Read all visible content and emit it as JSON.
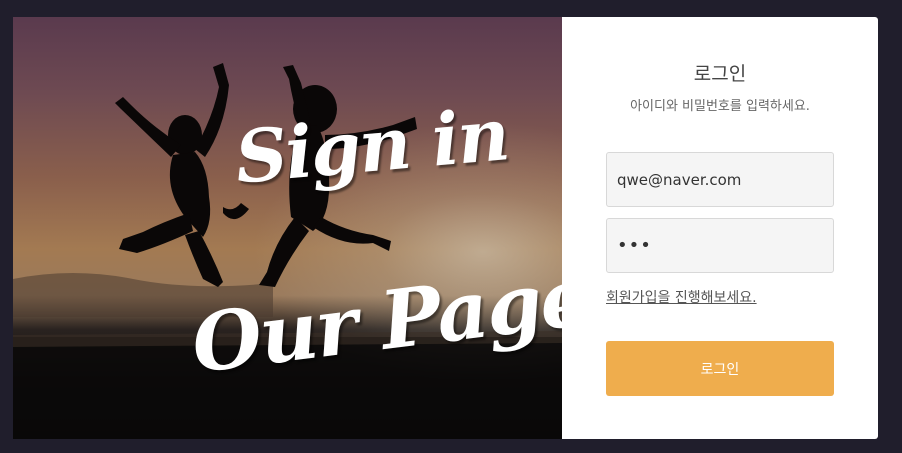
{
  "hero": {
    "line1": "Sign in",
    "line2": "Our Page!"
  },
  "login": {
    "title": "로그인",
    "subtitle": "아이디와 비밀번호를 입력하세요.",
    "email_value": "qwe@naver.com",
    "password_value": "•••",
    "signup_link": "회원가입을 진행해보세요.",
    "submit_label": "로그인"
  },
  "colors": {
    "page_background": "#201e2c",
    "button": "#efad4d",
    "field_background": "#f5f5f5"
  }
}
